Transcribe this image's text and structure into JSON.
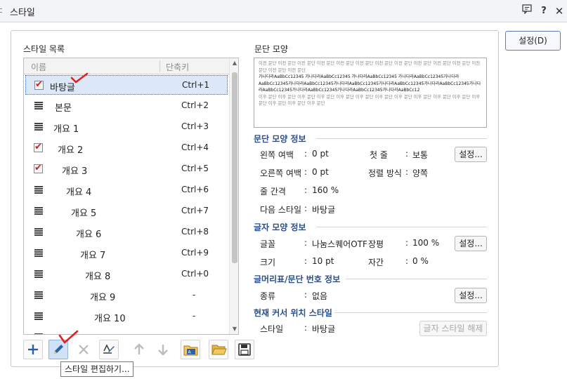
{
  "window": {
    "title": "스타일"
  },
  "list": {
    "section_label": "스타일 목록",
    "col_name": "이름",
    "col_key": "단축키",
    "rows": [
      {
        "name": "바탕글",
        "key": "Ctrl+1",
        "type": "para"
      },
      {
        "name": "본문",
        "key": "Ctrl+2",
        "type": "lines"
      },
      {
        "name": "개요 1",
        "key": "Ctrl+3",
        "type": "lines"
      },
      {
        "name": "개요 2",
        "key": "Ctrl+4",
        "type": "para"
      },
      {
        "name": "개요 3",
        "key": "Ctrl+5",
        "type": "para"
      },
      {
        "name": "개요 4",
        "key": "Ctrl+6",
        "type": "lines"
      },
      {
        "name": "개요 5",
        "key": "Ctrl+7",
        "type": "lines"
      },
      {
        "name": "개요 6",
        "key": "Ctrl+8",
        "type": "lines"
      },
      {
        "name": "개요 7",
        "key": "Ctrl+9",
        "type": "lines"
      },
      {
        "name": "개요 8",
        "key": "Ctrl+0",
        "type": "lines"
      },
      {
        "name": "개요 9",
        "key": "-",
        "type": "lines"
      },
      {
        "name": "개요 10",
        "key": "-",
        "type": "lines"
      },
      {
        "name": "",
        "key": "",
        "type": "lines"
      }
    ]
  },
  "preview": {
    "label": "문단 모양",
    "prev_text": "이전 문단 이전 문단 이전 문단 이전 문단 이전 문단 이전 문단 이전 문단 이전 문단 이전 문단 이전 문단 이전 문단 이전 문단 이전 문단 이전 문단",
    "sample_text": "가나다라AaBbCc12345 가나다라AaBbCc12345 가나다라AaBbCc12345 가나다라AaBbCc12345가나다라AaBbCc12345가나다라AaBbCc12345가나다라AaBbCc12345가나다라AaBbCc12345가나다라AaBbCc12345가나다라AaBbCc12345가나다라AaBbCc12345가나다라AaBbCc12345가나다라AaBbCc12",
    "next_text": "이후 문단 이후 문단 이후 문단 이후 문단 이후 문단 이후 문단 이후 문단 이후 문단 이후 문단 이후 문단 이후 문단 이후 문단 이후 문단 이후 문단 이후 문단"
  },
  "para_info": {
    "heading": "문단 모양 정보",
    "left_margin_label": "왼쪽 여백",
    "left_margin_value": "0 pt",
    "first_line_label": "첫 줄",
    "first_line_value": "보통",
    "right_margin_label": "오른쪽 여백",
    "right_margin_value": "0 pt",
    "align_label": "정렬 방식",
    "align_value": "양쪽",
    "line_spacing_label": "줄 간격",
    "line_spacing_value": "160 %",
    "next_style_label": "다음 스타일",
    "next_style_value": "바탕글",
    "settings_label": "설정..."
  },
  "char_info": {
    "heading": "글자 모양 정보",
    "font_label": "글꼴",
    "font_value": "나눔스퀘어OTF",
    "ratio_label": "장평",
    "ratio_value": "100 %",
    "size_label": "크기",
    "size_value": "10 pt",
    "spacing_label": "자간",
    "spacing_value": "0 %",
    "settings_label": "설정..."
  },
  "bullet_info": {
    "heading": "글머리표/문단 번호 정보",
    "kind_label": "종류",
    "kind_value": "없음",
    "settings_label": "설정..."
  },
  "cursor_info": {
    "heading": "현재 커서 위치 스타일",
    "style_label": "스타일",
    "style_value": "바탕글",
    "clear_label": "글자 스타일 해제"
  },
  "sep": ":",
  "apply_button": "설정(D)",
  "tooltip": "스타일 편집하기...",
  "toolbar": [
    "add-style",
    "edit-style",
    "delete-style",
    "replace-style",
    "move-up",
    "move-down",
    "import-style",
    "open-folder",
    "save-style"
  ]
}
